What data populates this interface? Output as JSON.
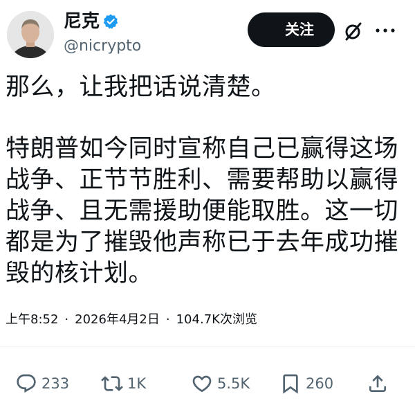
{
  "author": {
    "display_name": "尼克",
    "handle": "@nicrypto",
    "verified": true
  },
  "header": {
    "follow_label": "关注",
    "grok_icon": "grok-slash-icon",
    "more_icon": "more-dots-icon"
  },
  "tweet": {
    "paragraph_1": "那么，让我把话说清楚。",
    "paragraph_2": "特朗普如今同时宣称自己已赢得这场战争、正节节胜利、需要帮助以赢得战争、且无需援助便能取胜。这一切都是为了摧毁他声称已于去年成功摧毁的核计划。"
  },
  "meta": {
    "time": "上午8:52",
    "date": "2026年4月2日",
    "views": "104.7K次浏览",
    "separator": "·"
  },
  "actions": {
    "replies": "233",
    "retweets": "1K",
    "likes": "5.5K",
    "bookmarks": "260"
  },
  "colors": {
    "text_primary": "#0f1419",
    "text_secondary": "#536471",
    "verified_blue": "#1d9bf0",
    "follow_bg": "#0f1419"
  }
}
